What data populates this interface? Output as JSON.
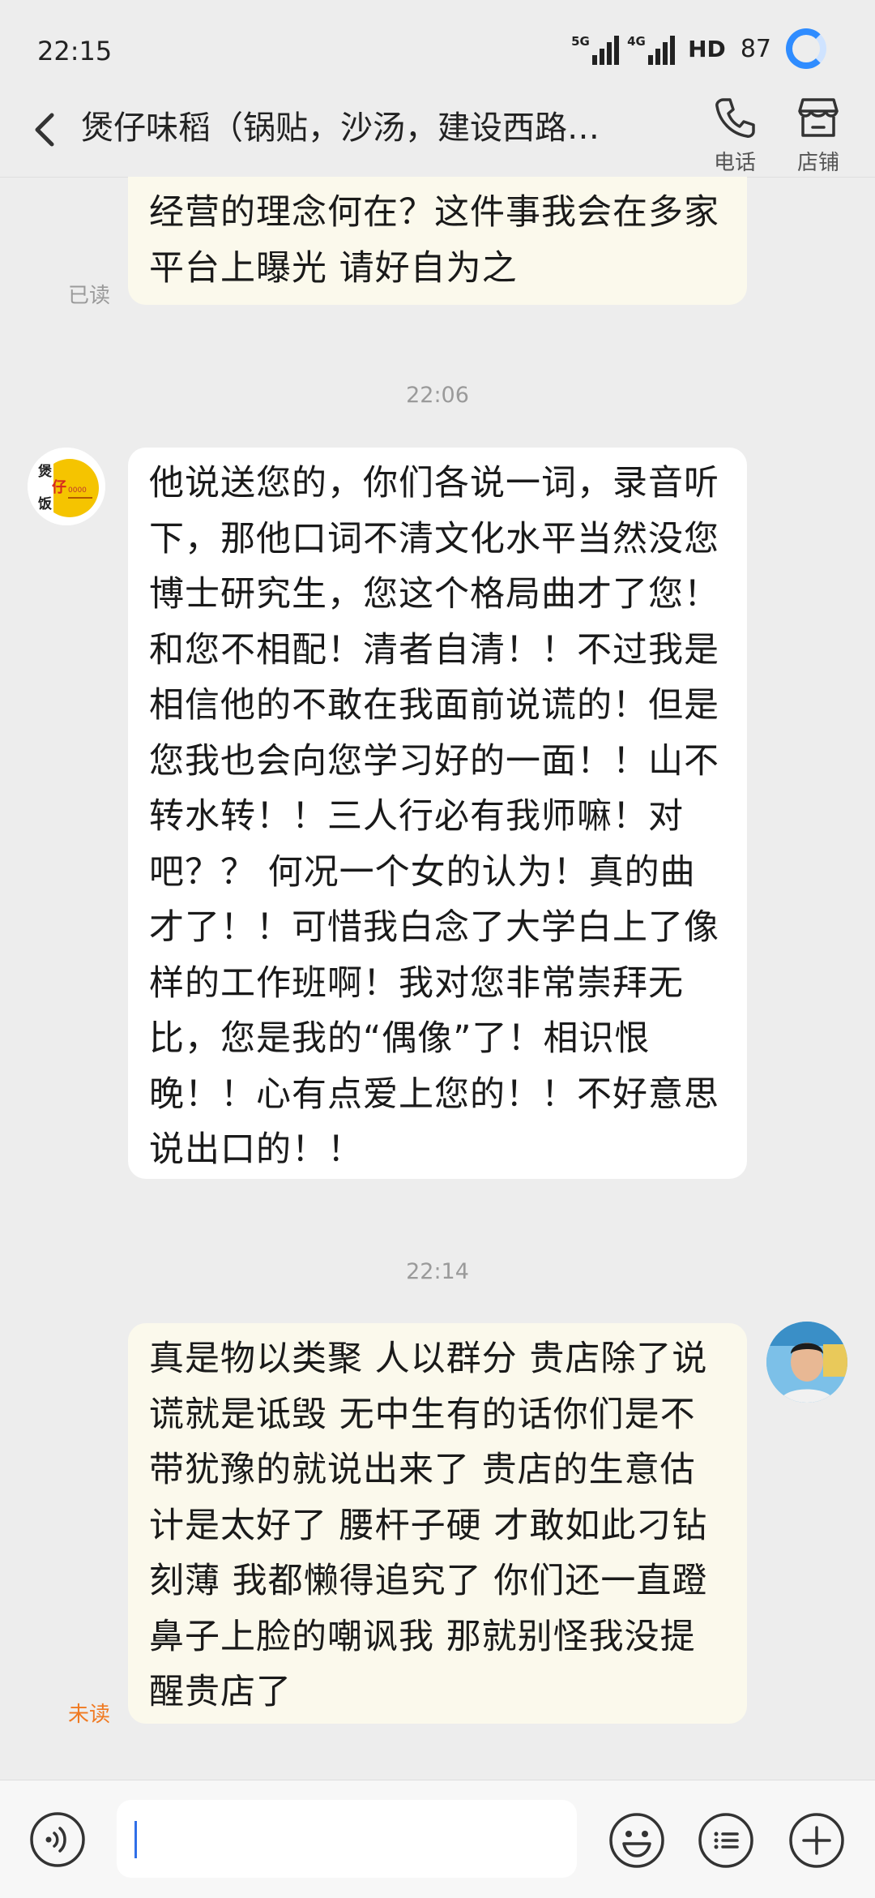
{
  "status_bar": {
    "time": "22:15",
    "signal1_label": "5G",
    "signal2_label": "4G",
    "hd_label": "HD",
    "battery": "87"
  },
  "header": {
    "title": "煲仔味稻（锅贴，沙汤，建设西路…",
    "phone_label": "电话",
    "shop_label": "店铺"
  },
  "messages": [
    {
      "sender": "me",
      "text": "经营的理念何在？这件事我会在多家平台上曝光 请好自为之",
      "status": "已读"
    },
    {
      "timestamp": "22:06"
    },
    {
      "sender": "shop",
      "text": "他说送您的，你们各说一词，录音听下，那他口词不清文化水平当然没您博士研究生，您这个格局曲才了您！和您不相配！清者自清！！不过我是相信他的不敢在我面前说谎的！但是您我也会向您学习好的一面！！山不转水转！！三人行必有我师嘛！对吧？？ 何况一个女的认为！真的曲才了！！可惜我白念了大学白上了像样的工作班啊！我对您非常崇拜无比，您是我的“偶像”了！相识恨晚！！心有点爱上您的！！不好意思说出口的！！"
    },
    {
      "timestamp": "22:14"
    },
    {
      "sender": "me",
      "text": "真是物以类聚 人以群分 贵店除了说谎就是诋毁  无中生有的话你们是不带犹豫的就说出来了  贵店的生意估计是太好了  腰杆子硬 才敢如此刁钻刻薄 我都懒得追究了 你们还一直蹬鼻子上脸的嘲讽我 那就别怪我没提醒贵店了",
      "status": "未读"
    }
  ],
  "shop_avatar_text": "煲仔饭",
  "input": {
    "value": ""
  },
  "colors": {
    "my_bubble": "#fbf9ec",
    "their_bubble": "#ffffff",
    "read": "#9a9a9a",
    "unread": "#f07a22",
    "accent": "#2f8cff",
    "background": "#ededed"
  }
}
